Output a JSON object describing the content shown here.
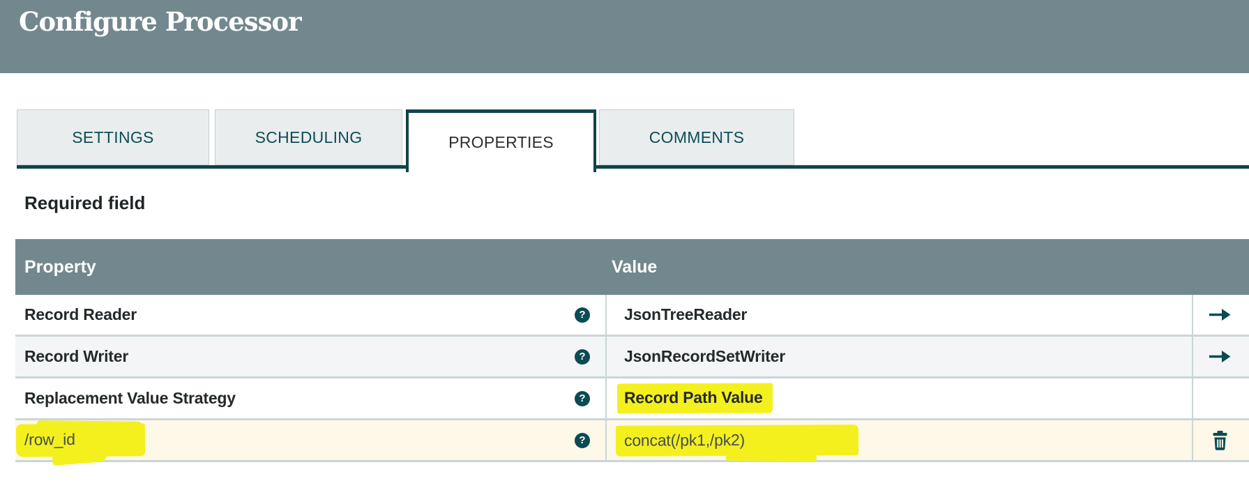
{
  "dialog": {
    "title": "Configure Processor"
  },
  "tabs": [
    {
      "label": "SETTINGS",
      "active": false
    },
    {
      "label": "SCHEDULING",
      "active": false
    },
    {
      "label": "PROPERTIES",
      "active": true
    },
    {
      "label": "COMMENTS",
      "active": false
    }
  ],
  "note": "Required field",
  "table": {
    "headers": {
      "property": "Property",
      "value": "Value"
    },
    "rows": [
      {
        "property": "Record Reader",
        "value": "JsonTreeReader",
        "action": "go-to-service",
        "highlighted": false
      },
      {
        "property": "Record Writer",
        "value": "JsonRecordSetWriter",
        "action": "go-to-service",
        "highlighted": false
      },
      {
        "property": "Replacement Value Strategy",
        "value": "Record Path Value",
        "action": "none",
        "highlighted": true
      },
      {
        "property": "/row_id",
        "value": "concat(/pk1,/pk2)",
        "action": "delete",
        "highlighted": true
      }
    ]
  },
  "icons": {
    "help": "?",
    "goto": "right-arrow",
    "delete": "trash-can"
  },
  "colors": {
    "header_bg": "#73888E",
    "accent_teal": "#0B4B53",
    "tab_underline": "#11444B",
    "tab_inactive_bg": "#E9EDEE",
    "alt_row_bg": "#F3F5F6",
    "new_row_bg": "#FDF8E7",
    "row_border": "#CBD5D8",
    "highlight_yellow": "#F4F01E"
  }
}
